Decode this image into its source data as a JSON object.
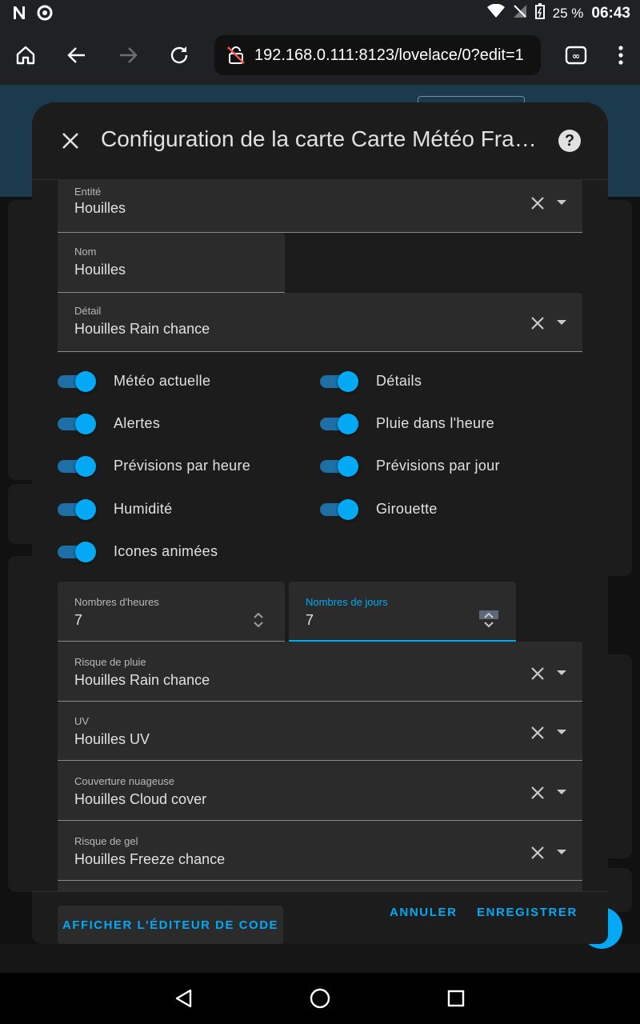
{
  "status": {
    "battery": "25 %",
    "time": "06:43"
  },
  "browser": {
    "url": "192.168.0.111:8123/lovelace/0?edit=1"
  },
  "dialog": {
    "title": "Configuration de la carte Carte Météo France",
    "help_label": "?",
    "fields": {
      "entity": {
        "label": "Entité",
        "value": "Houilles"
      },
      "name": {
        "label": "Nom",
        "value": "Houilles"
      },
      "detail": {
        "label": "Détail",
        "value": "Houilles Rain chance"
      },
      "hours": {
        "label": "Nombres d'heures",
        "value": "7"
      },
      "days": {
        "label": "Nombres de jours",
        "value": "7"
      },
      "rain": {
        "label": "Risque de pluie",
        "value": "Houilles Rain chance"
      },
      "uv": {
        "label": "UV",
        "value": "Houilles UV"
      },
      "cloud": {
        "label": "Couverture nuageuse",
        "value": "Houilles Cloud cover"
      },
      "freeze": {
        "label": "Risque de gel",
        "value": "Houilles Freeze chance"
      }
    },
    "toggles": [
      {
        "label": "Météo actuelle",
        "on": true
      },
      {
        "label": "Détails",
        "on": true
      },
      {
        "label": "Alertes",
        "on": true
      },
      {
        "label": "Pluie dans l'heure",
        "on": true
      },
      {
        "label": "Prévisions par heure",
        "on": true
      },
      {
        "label": "Prévisions par jour",
        "on": true
      },
      {
        "label": "Humidité",
        "on": true
      },
      {
        "label": "Girouette",
        "on": true
      },
      {
        "label": "Icones animées",
        "on": true
      }
    ],
    "footer": {
      "code_editor": "AFFICHER L'ÉDITEUR DE CODE",
      "cancel": "ANNULER",
      "save": "ENREGISTRER"
    }
  },
  "colors": {
    "accent": "#03a9f4",
    "dialog_bg": "#1c1c1c",
    "field_bg": "#2b2b2b"
  }
}
